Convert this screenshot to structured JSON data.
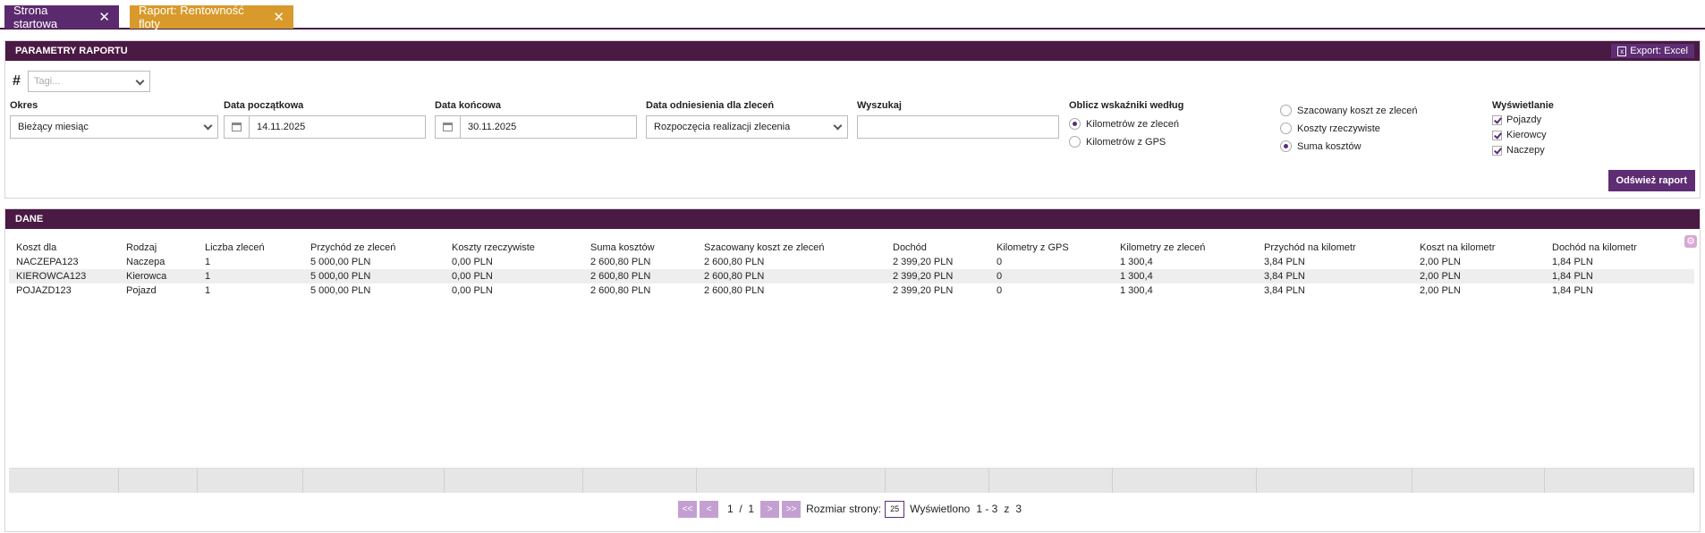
{
  "tabs": [
    {
      "label": "Strona startowa"
    },
    {
      "label": "Raport: Rentowność floty"
    }
  ],
  "params": {
    "title": "PARAMETRY RAPORTU",
    "export_label": "Export: Excel",
    "tags_placeholder": "Tagi...",
    "period_label": "Okres",
    "period_value": "Bieżący miesiąc",
    "start_label": "Data początkowa",
    "start_value": "14.11.2025",
    "end_label": "Data końcowa",
    "end_value": "30.11.2025",
    "ref_label": "Data odniesienia dla zleceń",
    "ref_value": "Rozpoczęcia realizacji zlecenia",
    "search_label": "Wyszukaj",
    "search_value": "",
    "calc_label": "Oblicz wskaźniki według",
    "calc_options": [
      "Kilometrów ze zleceń",
      "Kilometrów z GPS"
    ],
    "cost_options": [
      "Szacowany koszt ze zleceń",
      "Koszty rzeczywiste",
      "Suma kosztów"
    ],
    "display_label": "Wyświetlanie",
    "display_options": [
      "Pojazdy",
      "Kierowcy",
      "Naczepy"
    ],
    "refresh_label": "Odśwież raport"
  },
  "data_panel": {
    "title": "DANE",
    "columns": [
      "Koszt dla",
      "Rodzaj",
      "Liczba zleceń",
      "Przychód ze zleceń",
      "Koszty rzeczywiste",
      "Suma kosztów",
      "Szacowany koszt ze zleceń",
      "Dochód",
      "Kilometry z GPS",
      "Kilometry ze zleceń",
      "Przychód na kilometr",
      "Koszt na kilometr",
      "Dochód na kilometr"
    ],
    "rows": [
      [
        "NACZEPA123",
        "Naczepa",
        "1",
        "5 000,00 PLN",
        "0,00 PLN",
        "2 600,80 PLN",
        "2 600,80 PLN",
        "2 399,20 PLN",
        "0",
        "1 300,4",
        "3,84 PLN",
        "2,00 PLN",
        "1,84 PLN"
      ],
      [
        "KIEROWCA123",
        "Kierowca",
        "1",
        "5 000,00 PLN",
        "0,00 PLN",
        "2 600,80 PLN",
        "2 600,80 PLN",
        "2 399,20 PLN",
        "0",
        "1 300,4",
        "3,84 PLN",
        "2,00 PLN",
        "1,84 PLN"
      ],
      [
        "POJAZD123",
        "Pojazd",
        "1",
        "5 000,00 PLN",
        "0,00 PLN",
        "2 600,80 PLN",
        "2 600,80 PLN",
        "2 399,20 PLN",
        "0",
        "1 300,4",
        "3,84 PLN",
        "2,00 PLN",
        "1,84 PLN"
      ]
    ]
  },
  "pager": {
    "first": "<<",
    "prev": "<",
    "next": ">",
    "last": ">>",
    "page": "1",
    "sep": "/",
    "pages": "1",
    "size_label": "Rozmiar strony:",
    "size": "25",
    "shown_label": "Wyświetlono",
    "range": "1 - 3",
    "of": "z",
    "total": "3"
  }
}
